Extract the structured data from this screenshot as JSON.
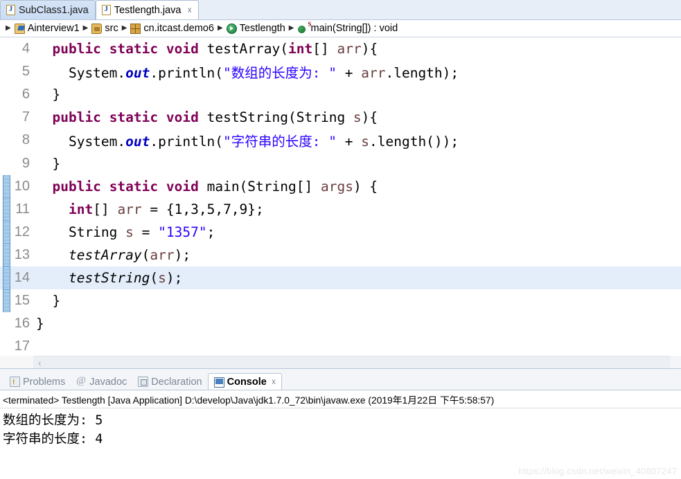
{
  "editor_tabs": [
    {
      "label": "SubClass1.java",
      "icon": "java-file-icon",
      "active": false,
      "closable": false
    },
    {
      "label": "Testlength.java",
      "icon": "java-file-icon",
      "active": true,
      "closable": true,
      "close_glyph": "☓"
    }
  ],
  "breadcrumb": {
    "separator": "▶",
    "items": [
      {
        "label": "Ainterview1",
        "icon": "java-project-icon"
      },
      {
        "label": "src",
        "icon": "source-folder-icon"
      },
      {
        "label": "cn.itcast.demo6",
        "icon": "package-icon"
      },
      {
        "label": "Testlength",
        "icon": "class-icon"
      },
      {
        "label": "main(String[]) : void",
        "icon": "method-static-icon",
        "superscript": "S"
      }
    ]
  },
  "code": {
    "first_line": 4,
    "highlighted_line": 14,
    "change_bar_lines": [
      10,
      11,
      12,
      13,
      14,
      15
    ],
    "lines": [
      {
        "n": 4,
        "tokens": [
          {
            "t": "  ",
            "c": "pln"
          },
          {
            "t": "public",
            "c": "kw"
          },
          {
            "t": " ",
            "c": "pln"
          },
          {
            "t": "static",
            "c": "kw"
          },
          {
            "t": " ",
            "c": "pln"
          },
          {
            "t": "void",
            "c": "kw"
          },
          {
            "t": " testArray(",
            "c": "pln"
          },
          {
            "t": "int",
            "c": "kw"
          },
          {
            "t": "[] ",
            "c": "pln"
          },
          {
            "t": "arr",
            "c": "var"
          },
          {
            "t": "){",
            "c": "pln"
          }
        ]
      },
      {
        "n": 5,
        "tokens": [
          {
            "t": "    System.",
            "c": "pln"
          },
          {
            "t": "out",
            "c": "fld"
          },
          {
            "t": ".println(",
            "c": "pln"
          },
          {
            "t": "\"数组的长度为: \"",
            "c": "str"
          },
          {
            "t": " + ",
            "c": "pln"
          },
          {
            "t": "arr",
            "c": "var"
          },
          {
            "t": ".length);",
            "c": "pln"
          }
        ]
      },
      {
        "n": 6,
        "tokens": [
          {
            "t": "  }",
            "c": "pln"
          }
        ]
      },
      {
        "n": 7,
        "tokens": [
          {
            "t": "  ",
            "c": "pln"
          },
          {
            "t": "public",
            "c": "kw"
          },
          {
            "t": " ",
            "c": "pln"
          },
          {
            "t": "static",
            "c": "kw"
          },
          {
            "t": " ",
            "c": "pln"
          },
          {
            "t": "void",
            "c": "kw"
          },
          {
            "t": " testString(String ",
            "c": "pln"
          },
          {
            "t": "s",
            "c": "var"
          },
          {
            "t": "){",
            "c": "pln"
          }
        ]
      },
      {
        "n": 8,
        "tokens": [
          {
            "t": "    System.",
            "c": "pln"
          },
          {
            "t": "out",
            "c": "fld"
          },
          {
            "t": ".println(",
            "c": "pln"
          },
          {
            "t": "\"字符串的长度: \"",
            "c": "str"
          },
          {
            "t": " + ",
            "c": "pln"
          },
          {
            "t": "s",
            "c": "var"
          },
          {
            "t": ".length());",
            "c": "pln"
          }
        ]
      },
      {
        "n": 9,
        "tokens": [
          {
            "t": "  }",
            "c": "pln"
          }
        ]
      },
      {
        "n": 10,
        "tokens": [
          {
            "t": "  ",
            "c": "pln"
          },
          {
            "t": "public",
            "c": "kw"
          },
          {
            "t": " ",
            "c": "pln"
          },
          {
            "t": "static",
            "c": "kw"
          },
          {
            "t": " ",
            "c": "pln"
          },
          {
            "t": "void",
            "c": "kw"
          },
          {
            "t": " main(String[] ",
            "c": "pln"
          },
          {
            "t": "args",
            "c": "var"
          },
          {
            "t": ") {",
            "c": "pln"
          }
        ]
      },
      {
        "n": 11,
        "tokens": [
          {
            "t": "    ",
            "c": "pln"
          },
          {
            "t": "int",
            "c": "kw"
          },
          {
            "t": "[] ",
            "c": "pln"
          },
          {
            "t": "arr",
            "c": "var"
          },
          {
            "t": " = {1,3,5,7,9};",
            "c": "pln"
          }
        ]
      },
      {
        "n": 12,
        "tokens": [
          {
            "t": "    String ",
            "c": "pln"
          },
          {
            "t": "s",
            "c": "var"
          },
          {
            "t": " = ",
            "c": "pln"
          },
          {
            "t": "\"1357\"",
            "c": "str"
          },
          {
            "t": ";",
            "c": "pln"
          }
        ]
      },
      {
        "n": 13,
        "tokens": [
          {
            "t": "    ",
            "c": "pln"
          },
          {
            "t": "testArray",
            "c": "mth"
          },
          {
            "t": "(",
            "c": "pln"
          },
          {
            "t": "arr",
            "c": "var"
          },
          {
            "t": ");",
            "c": "pln"
          }
        ]
      },
      {
        "n": 14,
        "tokens": [
          {
            "t": "    ",
            "c": "pln"
          },
          {
            "t": "testString",
            "c": "mth"
          },
          {
            "t": "(",
            "c": "pln"
          },
          {
            "t": "s",
            "c": "var"
          },
          {
            "t": ");",
            "c": "pln"
          }
        ]
      },
      {
        "n": 15,
        "tokens": [
          {
            "t": "  }",
            "c": "pln"
          }
        ]
      },
      {
        "n": 16,
        "tokens": [
          {
            "t": "}",
            "c": "pln"
          }
        ]
      },
      {
        "n": 17,
        "tokens": [
          {
            "t": "",
            "c": "pln"
          }
        ]
      }
    ]
  },
  "editor_scroll": {
    "left_arrow": "‹"
  },
  "view_tabs": [
    {
      "label": "Problems",
      "icon": "problems-icon",
      "active": false
    },
    {
      "label": "Javadoc",
      "icon": "javadoc-icon",
      "active": false
    },
    {
      "label": "Declaration",
      "icon": "declaration-icon",
      "active": false
    },
    {
      "label": "Console",
      "icon": "console-icon",
      "active": true,
      "close_glyph": "☓"
    }
  ],
  "console": {
    "launch_line": "<terminated> Testlength [Java Application] D:\\develop\\Java\\jdk1.7.0_72\\bin\\javaw.exe (2019年1月22日 下午5:58:57)",
    "output": "数组的长度为: 5\n字符串的长度: 4"
  },
  "watermark": "https://blog.csdn.net/weixin_40807247",
  "colors": {
    "keyword": "#7f0055",
    "string": "#2a00ff",
    "field": "#0000c0",
    "variable": "#6a3e3e",
    "highlight_line": "#e4eefb",
    "tab_active_bg": "#ffffff",
    "tab_inactive_bg": "#cfe0f5"
  }
}
